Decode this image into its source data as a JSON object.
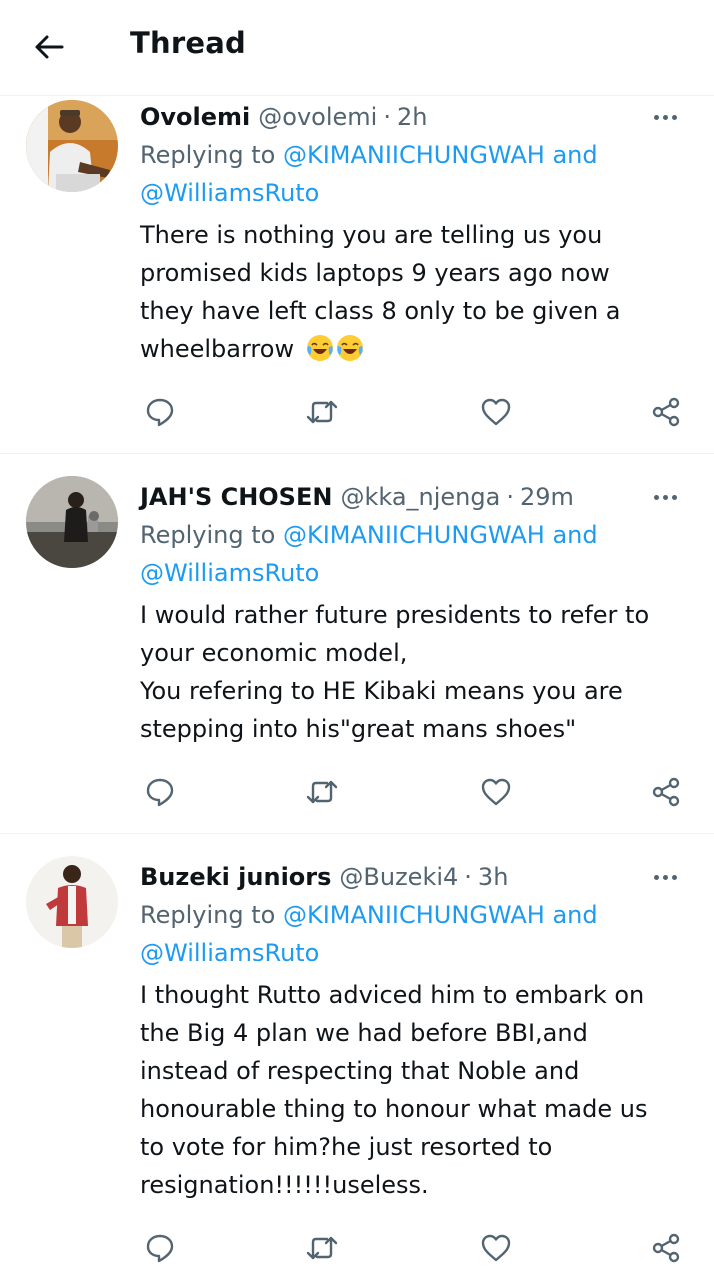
{
  "header": {
    "title": "Thread"
  },
  "tweets": [
    {
      "name": "Ovolemi",
      "handle": "@ovolemi",
      "separator": "·",
      "time": "2h",
      "replying_prefix": "Replying to",
      "reply_mention_1": "@KIMANIICHUNGWAH",
      "reply_and": "and",
      "reply_mention_2": "@WilliamsRuto",
      "lines": [
        "There is nothing you are telling us you",
        "promised kids laptops 9 years ago now",
        "they have left class 8 only to be given a",
        "wheelbarrow"
      ],
      "emoji": [
        "face-with-tears-of-joy",
        "face-with-tears-of-joy"
      ]
    },
    {
      "name": "JAH'S CHOSEN",
      "handle": "@kka_njenga",
      "separator": "·",
      "time": "29m",
      "replying_prefix": "Replying to",
      "reply_mention_1": "@KIMANIICHUNGWAH",
      "reply_and": "and",
      "reply_mention_2": "@WilliamsRuto",
      "lines": [
        "I would rather future presidents to refer to",
        "your economic model,",
        "You refering to HE Kibaki means you are",
        "stepping into his\"great mans shoes\""
      ]
    },
    {
      "name": "Buzeki juniors",
      "handle": "@Buzeki4",
      "separator": "·",
      "time": "3h",
      "replying_prefix": "Replying to",
      "reply_mention_1": "@KIMANIICHUNGWAH",
      "reply_and": "and",
      "reply_mention_2": "@WilliamsRuto",
      "lines": [
        "I thought Rutto adviced him to embark on",
        "the Big 4 plan we had before BBI,and",
        "instead of respecting that Noble and",
        "honourable thing to honour what made us",
        "to vote for him?he just resorted to",
        "resignation!!!!!!useless."
      ]
    }
  ],
  "icons": {
    "back": "arrow-left-icon",
    "more": "more-horizontal-icon",
    "reply": "reply-icon",
    "retweet": "retweet-icon",
    "like": "heart-icon",
    "share": "share-icon"
  },
  "colors": {
    "text": "#0f1419",
    "secondary": "#536471",
    "link": "#1d9bf0",
    "divider": "#eff3f4"
  }
}
